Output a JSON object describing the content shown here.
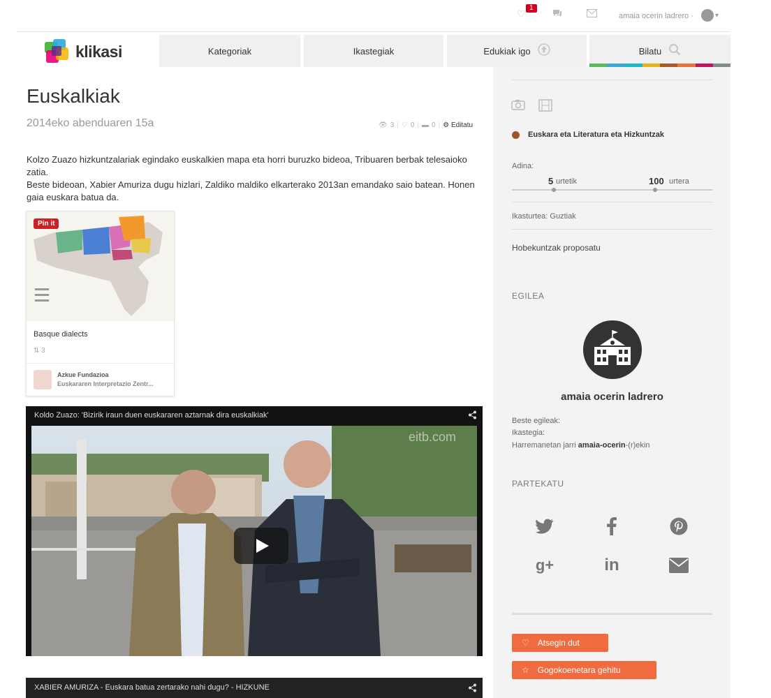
{
  "topbar": {
    "notif_count": "1",
    "user_name": "amaia ocerin ladrero ·"
  },
  "nav": {
    "logo_text": "klikasi",
    "items": [
      {
        "label": "Kategoriak"
      },
      {
        "label": "Ikastegiak"
      },
      {
        "label": "Edukiak igo"
      },
      {
        "label": "Bilatu"
      }
    ],
    "color_strip": [
      "#5cb85c",
      "#3aa9d8",
      "#1fb5c9",
      "#e2b31c",
      "#a65c2a",
      "#e7733c",
      "#c0175a",
      "#7f8c8d"
    ]
  },
  "page": {
    "title": "Euskalkiak",
    "date": "2014eko abenduaren 15a",
    "stats": {
      "views": "3",
      "likes": "0",
      "comments": "0",
      "edit_label": "Editatu"
    },
    "description": [
      "Kolzo Zuazo hizkuntzalariak egindako euskalkien mapa eta horri buruzko bideoa, Tribuaren berbak telesaioko zatia.",
      "Beste bideoan, Xabier Amuriza dugu hizlari, Zaldiko maldiko elkarterako 2013an emandako saio batean. Honen gaia euskara batua da."
    ]
  },
  "pin_card": {
    "pin_label": "Pin it",
    "title": "Basque dialects",
    "repins": "3",
    "author": "Azkue Fundazioa",
    "org": "Euskararen Interpretazio Zentr..."
  },
  "video1": {
    "title": "Koldo Zuazo: 'Bizirik iraun duen euskararen aztarnak dira euskalkiak'",
    "watermark": "eitb.com"
  },
  "video2": {
    "title": "XABIER AMURIZA - Euskara batua zertarako nahi dugu? - HIZKUNE"
  },
  "sidebar": {
    "category": "Euskara eta Literatura eta Hizkuntzak",
    "age_label": "Adina:",
    "age_from": "5",
    "age_from_unit": "urtetik",
    "age_to": "100",
    "age_to_unit": "urtera",
    "course": "Ikasturtea: Guztiak",
    "improve": "Hobekuntzak proposatu",
    "author_heading": "EGILEA",
    "author_name": "amaia ocerin ladrero",
    "other_authors": "Beste egileak:",
    "school": "Ikastegia:",
    "contact_prefix": "Harremanetan jarri ",
    "contact_user": "amaia-ocerin",
    "contact_suffix": "-(r)ekin",
    "share_heading": "PARTEKATU",
    "like_button": "Atsegin dut",
    "fav_button": "Gogokoenetara gehitu"
  }
}
